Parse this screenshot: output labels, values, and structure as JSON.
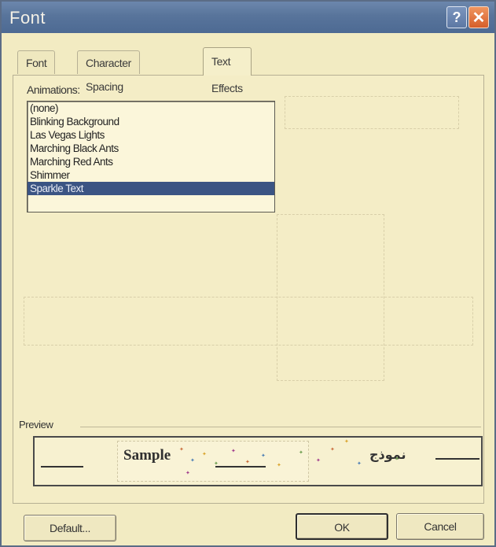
{
  "window": {
    "title": "Font",
    "help_glyph": "?",
    "close_glyph": "✕"
  },
  "tabs": [
    {
      "label": "Font",
      "active": false
    },
    {
      "label": "Character Spacing",
      "active": false
    },
    {
      "label": "Text Effects",
      "active": true
    }
  ],
  "animations": {
    "label": "Animations:",
    "items": [
      "(none)",
      "Blinking Background",
      "Las Vegas Lights",
      "Marching Black Ants",
      "Marching Red Ants",
      "Shimmer",
      "Sparkle Text"
    ],
    "selected": "Sparkle Text"
  },
  "preview": {
    "label": "Preview",
    "sample_text": "Sample",
    "rtl_text": "نموذج"
  },
  "buttons": {
    "default": "Default...",
    "ok": "OK",
    "cancel": "Cancel"
  },
  "colors": {
    "titlebar": "#58749b",
    "dialog_bg": "#f2ebc2",
    "selection": "#3b5483",
    "close_button": "#d65e2a"
  }
}
